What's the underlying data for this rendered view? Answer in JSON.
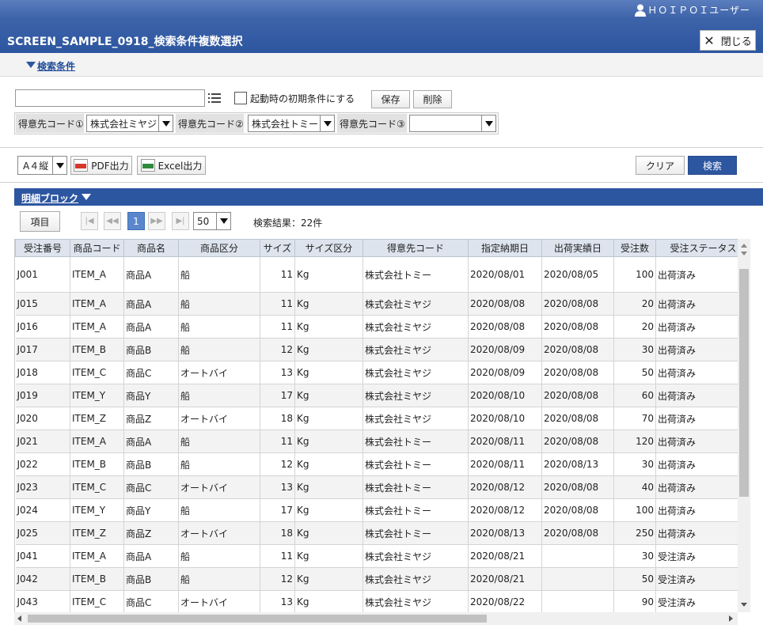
{
  "header": {
    "user": "ＨＯＩＰＯＩユーザー",
    "title": "SCREEN_SAMPLE_0918_検索条件複数選択",
    "close_label": "閉じる"
  },
  "conditions": {
    "toggle_label": "検索条件",
    "condition_name_value": "",
    "startup_checkbox_label": "起動時の初期条件にする",
    "save_label": "保存",
    "delete_label": "削除",
    "customers": [
      {
        "label": "得意先コード①",
        "value": "株式会社ミヤジ"
      },
      {
        "label": "得意先コード②",
        "value": "株式会社トミー"
      },
      {
        "label": "得意先コード③",
        "value": ""
      }
    ]
  },
  "toolbar": {
    "paper_size": "A４縦",
    "pdf_label": "PDF出力",
    "excel_label": "Excel出力",
    "clear_label": "クリア",
    "search_label": "検索"
  },
  "detail": {
    "title": "明細ブロック",
    "items_label": "項目",
    "current_page": "1",
    "page_size": "50",
    "result_text": "検索結果：22件"
  },
  "table": {
    "columns": [
      "受注番号",
      "商品コード",
      "商品名",
      "商品区分",
      "サイズ",
      "サイズ区分",
      "得意先コード",
      "指定納期日",
      "出荷実績日",
      "受注数",
      "受注ステータス"
    ],
    "rows": [
      [
        "J001",
        "ITEM_A",
        "商品A",
        "船",
        "11",
        "Kg",
        "株式会社トミー",
        "2020/08/01",
        "2020/08/05",
        "100",
        "出荷済み"
      ],
      [
        "J015",
        "ITEM_A",
        "商品A",
        "船",
        "11",
        "Kg",
        "株式会社ミヤジ",
        "2020/08/08",
        "2020/08/08",
        "20",
        "出荷済み"
      ],
      [
        "J016",
        "ITEM_A",
        "商品A",
        "船",
        "11",
        "Kg",
        "株式会社ミヤジ",
        "2020/08/08",
        "2020/08/08",
        "20",
        "出荷済み"
      ],
      [
        "J017",
        "ITEM_B",
        "商品B",
        "船",
        "12",
        "Kg",
        "株式会社ミヤジ",
        "2020/08/09",
        "2020/08/08",
        "30",
        "出荷済み"
      ],
      [
        "J018",
        "ITEM_C",
        "商品C",
        "オートバイ",
        "13",
        "Kg",
        "株式会社ミヤジ",
        "2020/08/09",
        "2020/08/08",
        "50",
        "出荷済み"
      ],
      [
        "J019",
        "ITEM_Y",
        "商品Y",
        "船",
        "17",
        "Kg",
        "株式会社ミヤジ",
        "2020/08/10",
        "2020/08/08",
        "60",
        "出荷済み"
      ],
      [
        "J020",
        "ITEM_Z",
        "商品Z",
        "オートバイ",
        "18",
        "Kg",
        "株式会社ミヤジ",
        "2020/08/10",
        "2020/08/08",
        "70",
        "出荷済み"
      ],
      [
        "J021",
        "ITEM_A",
        "商品A",
        "船",
        "11",
        "Kg",
        "株式会社トミー",
        "2020/08/11",
        "2020/08/08",
        "120",
        "出荷済み"
      ],
      [
        "J022",
        "ITEM_B",
        "商品B",
        "船",
        "12",
        "Kg",
        "株式会社トミー",
        "2020/08/11",
        "2020/08/13",
        "30",
        "出荷済み"
      ],
      [
        "J023",
        "ITEM_C",
        "商品C",
        "オートバイ",
        "13",
        "Kg",
        "株式会社トミー",
        "2020/08/12",
        "2020/08/08",
        "40",
        "出荷済み"
      ],
      [
        "J024",
        "ITEM_Y",
        "商品Y",
        "船",
        "17",
        "Kg",
        "株式会社トミー",
        "2020/08/12",
        "2020/08/08",
        "100",
        "出荷済み"
      ],
      [
        "J025",
        "ITEM_Z",
        "商品Z",
        "オートバイ",
        "18",
        "Kg",
        "株式会社トミー",
        "2020/08/13",
        "2020/08/08",
        "250",
        "出荷済み"
      ],
      [
        "J041",
        "ITEM_A",
        "商品A",
        "船",
        "11",
        "Kg",
        "株式会社ミヤジ",
        "2020/08/21",
        "",
        "30",
        "受注済み"
      ],
      [
        "J042",
        "ITEM_B",
        "商品B",
        "船",
        "12",
        "Kg",
        "株式会社ミヤジ",
        "2020/08/21",
        "",
        "50",
        "受注済み"
      ],
      [
        "J043",
        "ITEM_C",
        "商品C",
        "オートバイ",
        "13",
        "Kg",
        "株式会社ミヤジ",
        "2020/08/22",
        "",
        "90",
        "受注済み"
      ]
    ]
  },
  "colors": {
    "header_blue": "#2d56a0",
    "row_alt": "#f3f3f3",
    "table_header": "#dde4ee"
  }
}
